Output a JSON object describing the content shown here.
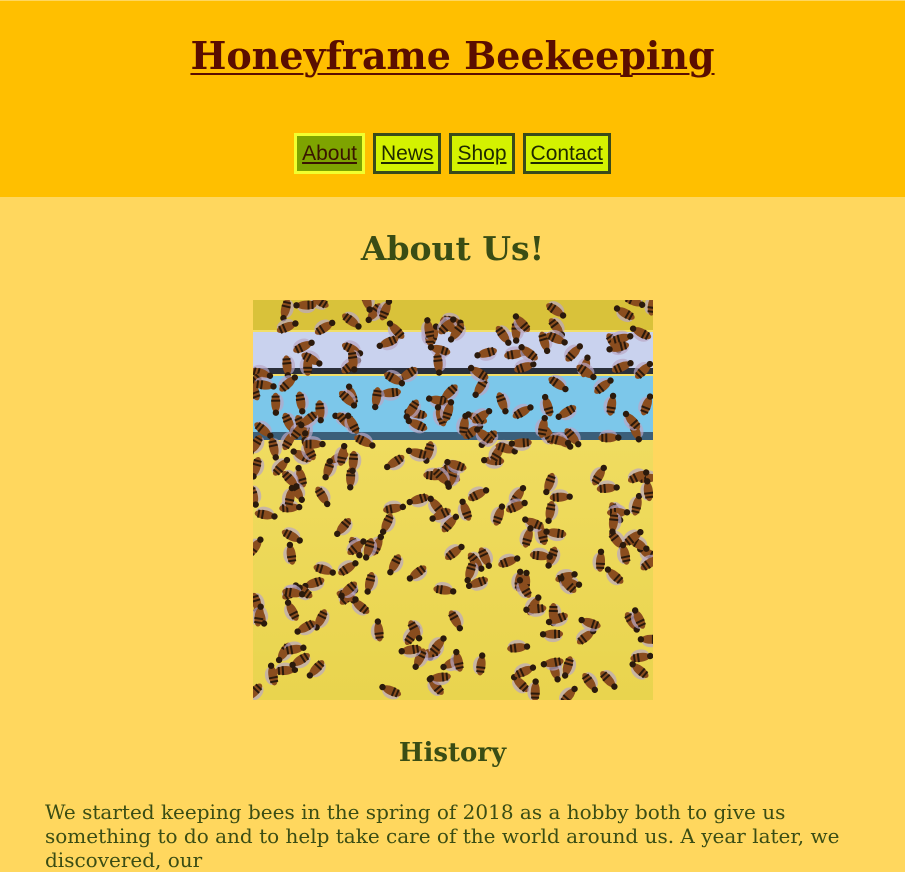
{
  "header": {
    "title": "Honeyframe Beekeeping",
    "background_color": "#ffbf00",
    "title_color": "#5a0e00"
  },
  "nav": {
    "items": [
      {
        "label": "About",
        "active": true
      },
      {
        "label": "News",
        "active": false
      },
      {
        "label": "Shop",
        "active": false
      },
      {
        "label": "Contact",
        "active": false
      }
    ],
    "button_color": "#d4f200",
    "active_color": "#7ea400"
  },
  "main": {
    "heading": "About Us!",
    "image_alt_icon": "honeybees-photo",
    "history_heading": "History",
    "history_text": "We started keeping bees in the spring of 2018 as a hobby both to give us something to do and to help take care of the world around us. A year later, we discovered, our",
    "background_color": "#ffd75e",
    "heading_color": "#3a4d14"
  }
}
